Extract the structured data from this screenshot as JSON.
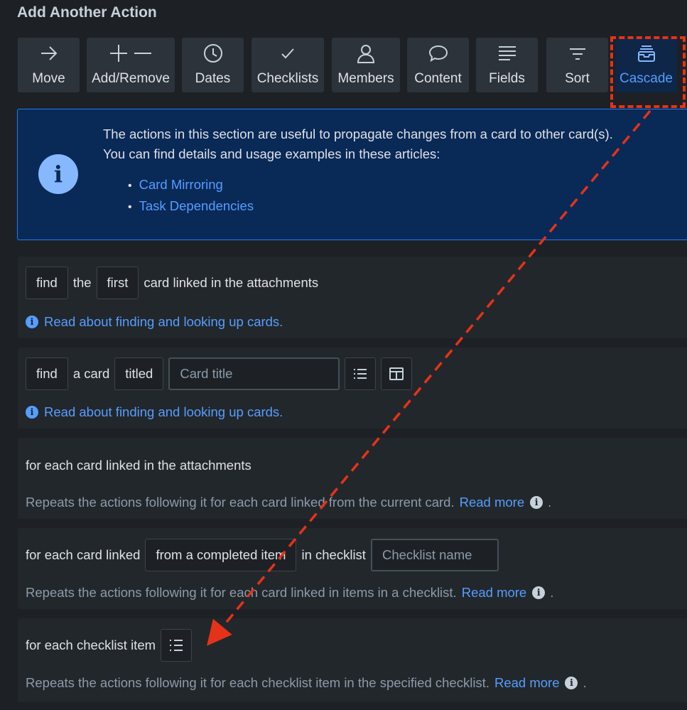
{
  "header": {
    "title": "Add Another Action"
  },
  "toolbar": {
    "items": [
      {
        "label": "Move",
        "icon": "arrow-right-icon"
      },
      {
        "label": "Add/Remove",
        "icon": "plus-minus-icon"
      },
      {
        "label": "Dates",
        "icon": "clock-icon"
      },
      {
        "label": "Checklists",
        "icon": "check-icon"
      },
      {
        "label": "Members",
        "icon": "person-icon"
      },
      {
        "label": "Content",
        "icon": "speech-bubble-icon"
      },
      {
        "label": "Fields",
        "icon": "lines-icon"
      },
      {
        "label": "Sort",
        "icon": "filter-icon"
      },
      {
        "label": "Cascade",
        "icon": "inbox-stack-icon",
        "active": true
      }
    ]
  },
  "info": {
    "line1": "The actions in this section are useful to propagate changes from a card to other card(s).",
    "line2": "You can find details and usage examples in these articles:",
    "links": [
      "Card Mirroring",
      "Task Dependencies"
    ]
  },
  "actions": {
    "a1": {
      "find": "find",
      "the": "the",
      "first": "first",
      "rest": "card linked in the attachments",
      "help": "Read about finding and looking up cards."
    },
    "a2": {
      "find": "find",
      "a_card": "a card",
      "titled": "titled",
      "placeholder": "Card title",
      "help": "Read about finding and looking up cards."
    },
    "a3": {
      "text": "for each card linked in the attachments",
      "desc": "Repeats the actions following it for each card linked from the current card.",
      "more": "Read more",
      "period": "."
    },
    "a4": {
      "text1": "for each card linked",
      "option": "from a completed item",
      "text2": "in checklist",
      "placeholder": "Checklist name",
      "desc": "Repeats the actions following it for each card linked in items in a checklist.",
      "more": "Read more",
      "period": "."
    },
    "a5": {
      "text": "for each checklist item",
      "desc": "Repeats the actions following it for each checklist item in the specified checklist.",
      "more": "Read more",
      "period": "."
    }
  },
  "colors": {
    "accent": "#579dff",
    "annotation": "#e5321a",
    "background": "#1d2125"
  }
}
